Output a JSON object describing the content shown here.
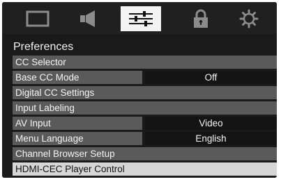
{
  "tabs": [
    {
      "icon": "picture-icon",
      "active": false
    },
    {
      "icon": "speaker-icon",
      "active": false
    },
    {
      "icon": "sliders-icon",
      "active": true
    },
    {
      "icon": "lock-icon",
      "active": false
    },
    {
      "icon": "gear-icon",
      "active": false
    }
  ],
  "page": {
    "title": "Preferences"
  },
  "menu": {
    "items": [
      {
        "label": "CC Selector"
      },
      {
        "label": "Base CC Mode",
        "value": "Off"
      },
      {
        "label": "Digital CC Settings"
      },
      {
        "label": "Input Labeling"
      },
      {
        "label": "AV Input",
        "value": "Video"
      },
      {
        "label": "Menu Language",
        "value": "English"
      },
      {
        "label": "Channel Browser Setup"
      },
      {
        "label": "HDMI-CEC Player Control"
      }
    ]
  },
  "colors": {
    "background": "#1a1a1a",
    "row": "#5a5a5a",
    "value_cell": "#141414",
    "highlight": "#d6d6d6",
    "active_tab": "#f3f3f3"
  }
}
